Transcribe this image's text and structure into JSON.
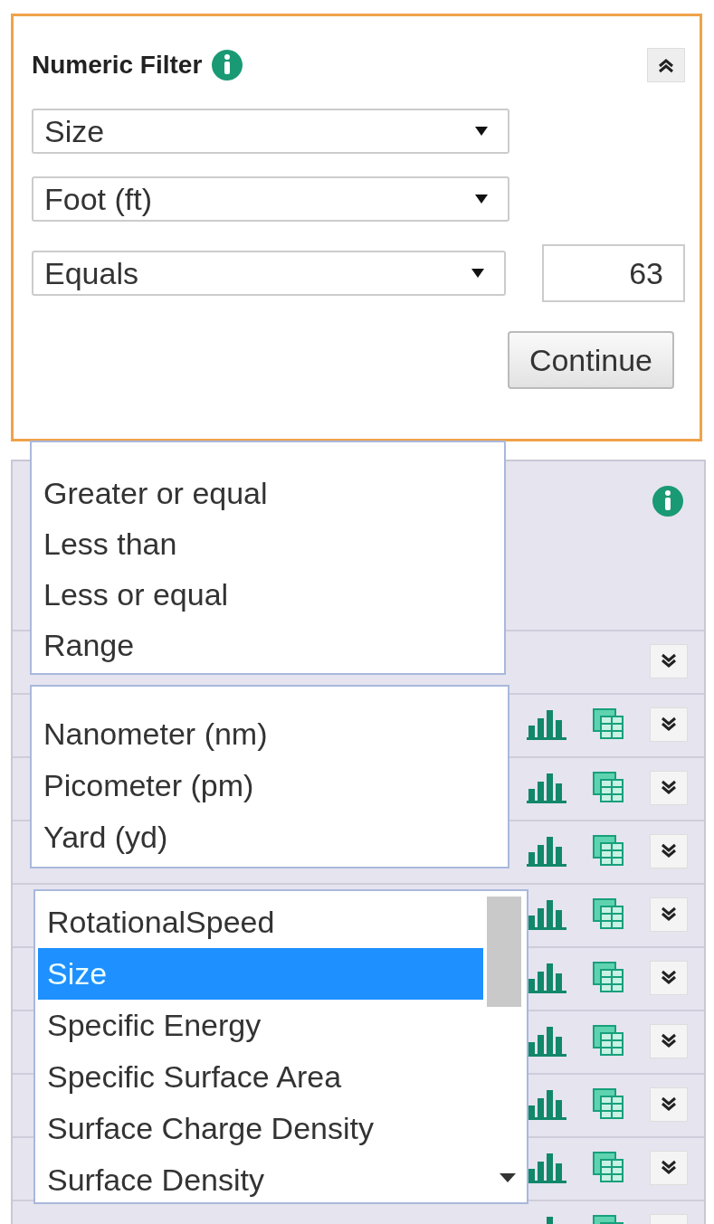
{
  "filter_panel": {
    "title": "Numeric Filter",
    "quantity_select": {
      "value": "Size"
    },
    "unit_select": {
      "value": "Foot (ft)"
    },
    "operator_select": {
      "value": "Equals"
    },
    "value_field": {
      "value": "63"
    },
    "continue_button": "Continue",
    "collapsed": false
  },
  "results_panel": {
    "rows": [
      {
        "kind": "group"
      },
      {
        "kind": "measure"
      },
      {
        "kind": "measure"
      },
      {
        "kind": "measure"
      },
      {
        "kind": "measure"
      },
      {
        "kind": "measure"
      },
      {
        "kind": "measure"
      },
      {
        "kind": "measure"
      },
      {
        "kind": "measure"
      },
      {
        "kind": "measure"
      }
    ]
  },
  "operator_options": [
    {
      "label": "Greater or equal",
      "selected": false
    },
    {
      "label": "Less than",
      "selected": false
    },
    {
      "label": "Less or equal",
      "selected": false
    },
    {
      "label": "Range",
      "selected": false
    }
  ],
  "unit_options": [
    {
      "label": "Nanometer (nm)",
      "selected": false
    },
    {
      "label": "Picometer (pm)",
      "selected": false
    },
    {
      "label": "Yard (yd)",
      "selected": false
    }
  ],
  "quantity_options": [
    {
      "label": "RotationalSpeed",
      "selected": false
    },
    {
      "label": "Size",
      "selected": true
    },
    {
      "label": "Specific Energy",
      "selected": false
    },
    {
      "label": "Specific Surface Area",
      "selected": false
    },
    {
      "label": "Surface Charge Density",
      "selected": false
    },
    {
      "label": "Surface Density",
      "selected": false
    }
  ]
}
